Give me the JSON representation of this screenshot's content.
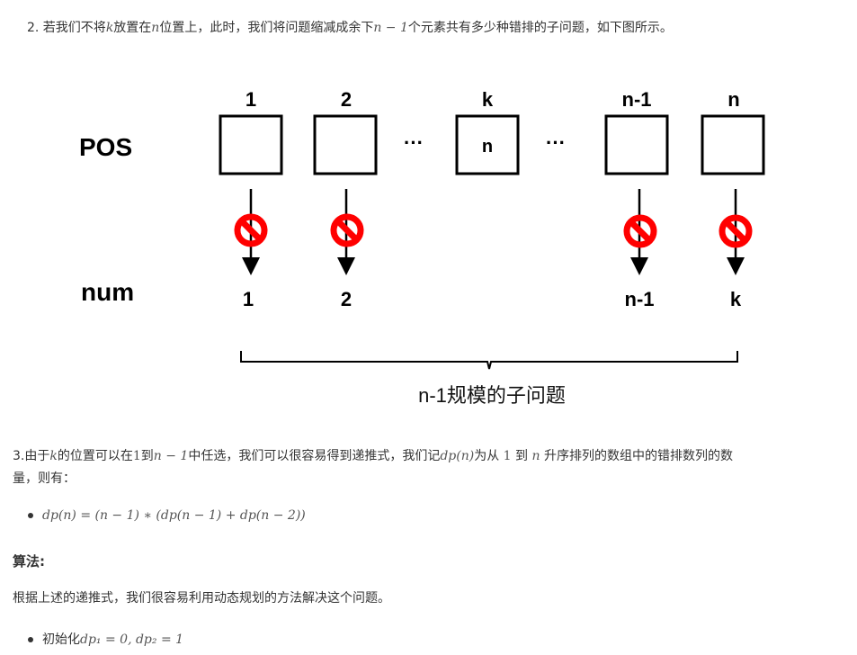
{
  "step2": {
    "prefix": "2. 若我们不将",
    "k": "k",
    "mid1": "放置在",
    "n": "n",
    "mid2": "位置上，此时，我们将问题缩减成余下",
    "nm1": "n − 1",
    "suffix": "个元素共有多少种错排的子问题，如下图所示。"
  },
  "diagram": {
    "pos_label": "POS",
    "num_label": "num",
    "top_labels": [
      "1",
      "2",
      "k",
      "n-1",
      "n"
    ],
    "box_k_content": "n",
    "ellipsis": "···",
    "bottom_labels": [
      "1",
      "2",
      "n-1",
      "k"
    ],
    "brace_label": "n-1规模的子问题",
    "prohibit_color": "#ff0000"
  },
  "step3": {
    "prefix": "3.由于",
    "k": "k",
    "mid1": "的位置可以在",
    "one": "1",
    "mid2": "到",
    "nm1": "n − 1",
    "mid3": "中任选，我们可以很容易得到递推式，我们记",
    "dpn": "dp(n)",
    "mid4": "为从",
    "one_b": "1",
    "mid5": "到",
    "n": "n",
    "suffix": "升序排列的数组中的错排数列的数",
    "line2": "量，则有："
  },
  "formula": "dp(n) = (n − 1) ∗ (dp(n − 1) + dp(n − 2))",
  "algo_heading": "算法:",
  "algo_text": "根据上述的递推式，我们很容易利用动态规划的方法解决这个问题。",
  "init": {
    "label": "初始化",
    "math": "dp₁ = 0, dp₂ = 1"
  }
}
